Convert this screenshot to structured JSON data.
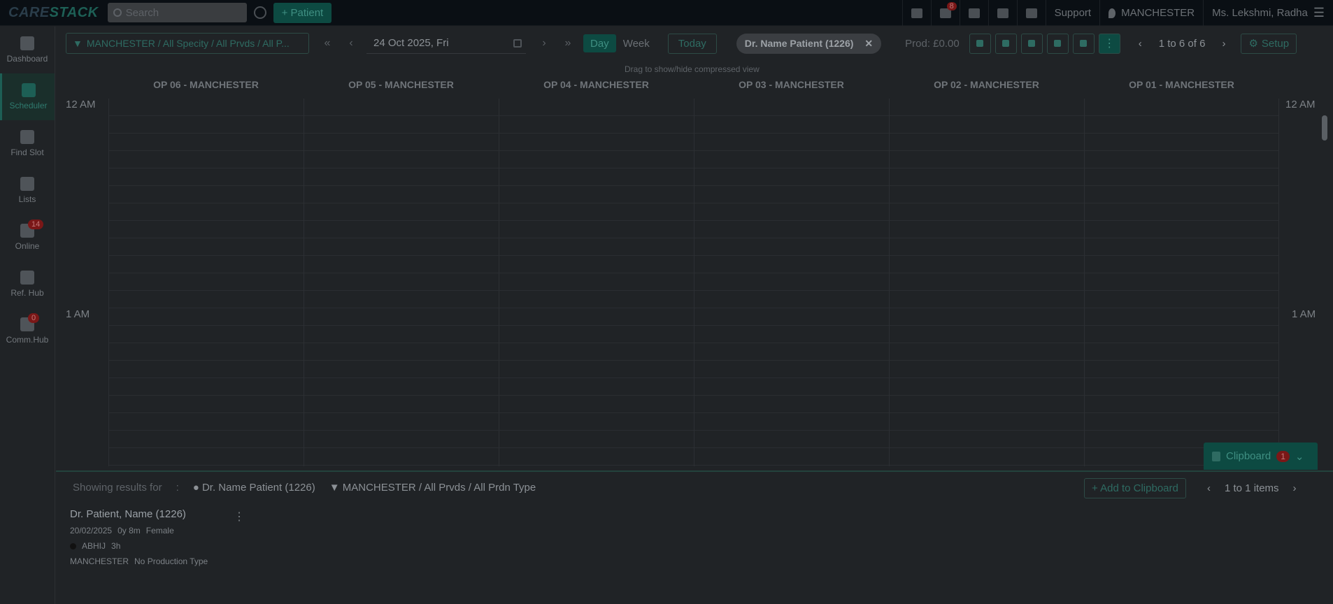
{
  "topbar": {
    "logo_a": "CARE",
    "logo_b": "STACK",
    "search_placeholder": "Search",
    "add_patient": "+ Patient",
    "notif_count": "8",
    "support": "Support",
    "location": "MANCHESTER",
    "user": "Ms. Lekshmi, Radha"
  },
  "sidebar": {
    "items": [
      {
        "label": "Dashboard",
        "badge": ""
      },
      {
        "label": "Scheduler",
        "badge": ""
      },
      {
        "label": "Find Slot",
        "badge": ""
      },
      {
        "label": "Lists",
        "badge": ""
      },
      {
        "label": "Online",
        "badge": "14"
      },
      {
        "label": "Ref. Hub",
        "badge": ""
      },
      {
        "label": "Comm.Hub",
        "badge": "0"
      }
    ]
  },
  "toolbar": {
    "filter": "MANCHESTER / All Specity / All Prvds / All P...",
    "date": "24 Oct 2025, Fri",
    "day": "Day",
    "week": "Week",
    "today": "Today",
    "chip": "Dr. Name Patient (1226)",
    "prod": "Prod: £0.00",
    "pager": "1 to 6 of 6",
    "setup": "Setup"
  },
  "drag_hint": "Drag to show/hide compressed view",
  "columns": [
    "OP 06 - MANCHESTER",
    "OP 05 - MANCHESTER",
    "OP 04 - MANCHESTER",
    "OP 03 - MANCHESTER",
    "OP 02 - MANCHESTER",
    "OP 01 - MANCHESTER"
  ],
  "times": {
    "t1": "12 AM",
    "t2": "1 AM"
  },
  "clipboard": {
    "label": "Clipboard",
    "count": "1"
  },
  "results": {
    "showing": "Showing results for",
    "patient": "Dr. Name Patient (1226)",
    "filter": "MANCHESTER / All Prvds / All Prdn Type",
    "add_clipboard": "+ Add to Clipboard",
    "pager": "1 to 1 items"
  },
  "card": {
    "name": "Dr. Patient, Name (1226)",
    "dob": "20/02/2025",
    "age": "0y 8m",
    "gender": "Female",
    "provider": "ABHIJ",
    "duration": "3h",
    "location": "MANCHESTER",
    "prod_type": "No Production Type"
  }
}
